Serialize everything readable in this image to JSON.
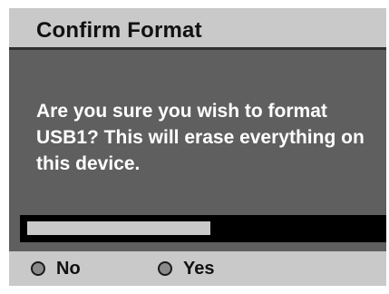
{
  "dialog": {
    "title": "Confirm Format",
    "message": "Are you sure you wish to format USB1? This will erase everything on this device."
  },
  "progress": {
    "value": 0.52
  },
  "buttons": {
    "no_label": "No",
    "yes_label": "Yes",
    "icon": "radio-circle-icon"
  },
  "colors": {
    "title_bar": "#c9c9c9",
    "body": "#5f5f5f",
    "progress_track": "#000000",
    "progress_fill": "#c9c9c9",
    "text_light": "#ffffff",
    "text_dark": "#111111"
  }
}
